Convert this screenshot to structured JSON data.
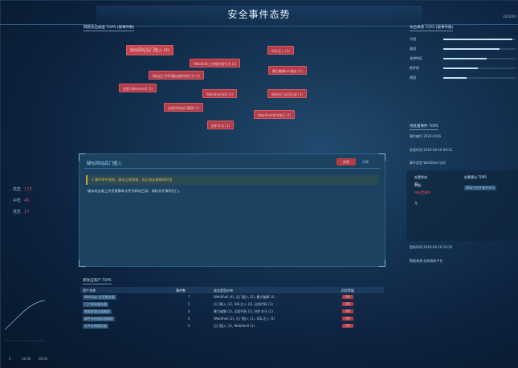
{
  "header": {
    "title": "安全事件态势",
    "time": "2024/04"
  },
  "left_panel": {
    "heading": "网络攻击类型 TOP5 (按事件数)",
    "rows": [
      {
        "label": "高危",
        "value": "173"
      },
      {
        "label": "中危",
        "value": "45"
      },
      {
        "label": "低危",
        "value": "17"
      }
    ],
    "time_ticks": [
      "0",
      "12:00",
      "18:00"
    ]
  },
  "tags": [
    {
      "text": "疑似网站后门植入 (4)",
      "big": true
    },
    {
      "text": "SQL注入 (1)",
      "big": false
    },
    {
      "text": "WebShell上传被利用行为 (1)",
      "big": false
    },
    {
      "text": "暴力破解ssh服务 (1)",
      "big": false
    },
    {
      "text": "网站后门(IIS)疑似被利用行为 (1)",
      "big": false
    },
    {
      "text": "恶意 (Webshell) (1)",
      "big": false
    },
    {
      "text": "WebShell访问 (1)",
      "big": false
    },
    {
      "text": "网站后门访问记录 (1)",
      "big": false
    },
    {
      "text": "远程代码执行漏洞 (1)",
      "big": false
    },
    {
      "text": "WebShell命令执行 (1)",
      "big": false
    },
    {
      "text": "挖矿木马 (1)",
      "big": false
    }
  ],
  "modal": {
    "title": "疑似网站后门植入",
    "btn_primary": "处理",
    "btn_secondary": "详情",
    "alert": "1 事件命中规则，建议立即排查，防止攻击者继续利用",
    "desc": "疑似攻击者上传恶意脚本文件到网站目录，请核实并清除后门。"
  },
  "right_panel": {
    "top_heading": "攻击来源 TOP5 (按事件数)",
    "bars": [
      {
        "label": "中国",
        "fill": 0.95
      },
      {
        "label": "美国",
        "fill": 0.78
      },
      {
        "label": "香港特区",
        "fill": 0.6
      },
      {
        "label": "俄罗斯",
        "fill": 0.48
      },
      {
        "label": "德国",
        "fill": 0.32
      }
    ],
    "section_heading": "待处置事件 TOP5",
    "items": [
      "事件编号 2024-0416",
      "发现时间 2024-04-16 08:21",
      "事件类型 WebShell 访问"
    ],
    "box": {
      "col1_head": "处置状态",
      "col2_head": "处置建议 TOP5",
      "count": "8",
      "count_unit": "起",
      "count_note": "待处置事件",
      "suggest": "隔离主机并查杀木马",
      "placeholder": "无"
    },
    "bottom_items": [
      "更新时间 2024-04-16 10:25",
      "数据来源 态势感知平台"
    ]
  },
  "table": {
    "heading": "受攻击资产 TOP5",
    "headers": [
      "资产名称",
      "事件数",
      "攻击类型分布",
      "风险等级"
    ],
    "rows": [
      {
        "name": "WebApp 应用服务器",
        "count": "7",
        "dist": "WebShell (4), 后门植入 (2), 暴力破解 (1)",
        "risk": "高危"
      },
      {
        "name": "门户网站服务器",
        "count": "5",
        "dist": "后门植入 (2), SQL注入 (2), 远程代码 (1)",
        "risk": "高危"
      },
      {
        "name": "数据库服务器集群",
        "count": "4",
        "dist": "暴力破解 (2), 远程代码 (1), 挖矿木马 (1)",
        "risk": "高危"
      },
      {
        "name": "邮件系统服务器集群",
        "count": "4",
        "dist": "WebShell (2), 后门植入 (1), SQL注入 (1)",
        "risk": "高危"
      },
      {
        "name": "文件存储服务器",
        "count": "3",
        "dist": "后门植入 (2), WebShell (1)",
        "risk": "高危"
      }
    ]
  }
}
